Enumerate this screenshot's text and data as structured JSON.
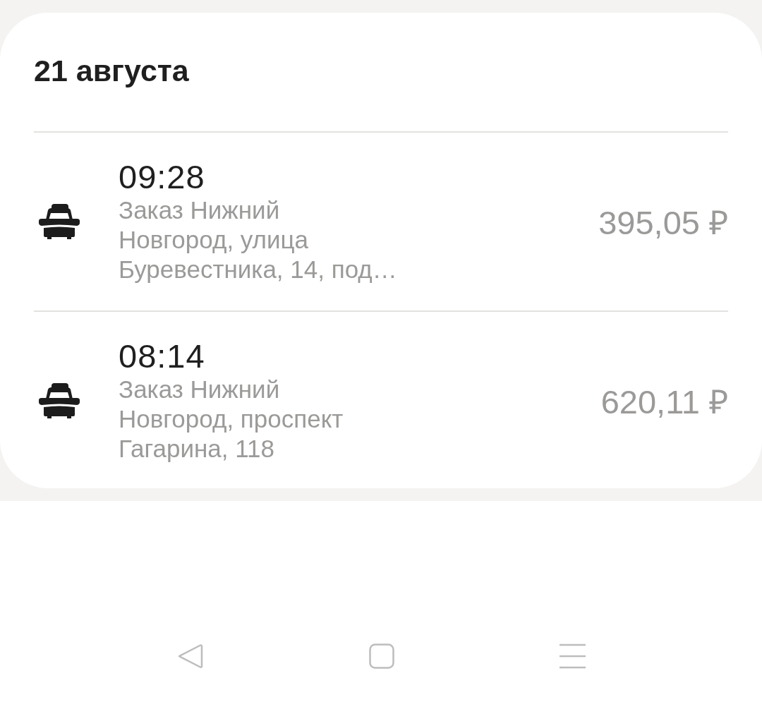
{
  "header": {
    "date": "21 августа"
  },
  "orders": [
    {
      "time": "09:28",
      "description": "Заказ Нижний Новгород, улица Буревестника, 14, под…",
      "price": "395,05 ₽"
    },
    {
      "time": "08:14",
      "description": "Заказ Нижний Новгород, проспект Гагарина, 118",
      "price": "620,11 ₽"
    }
  ]
}
